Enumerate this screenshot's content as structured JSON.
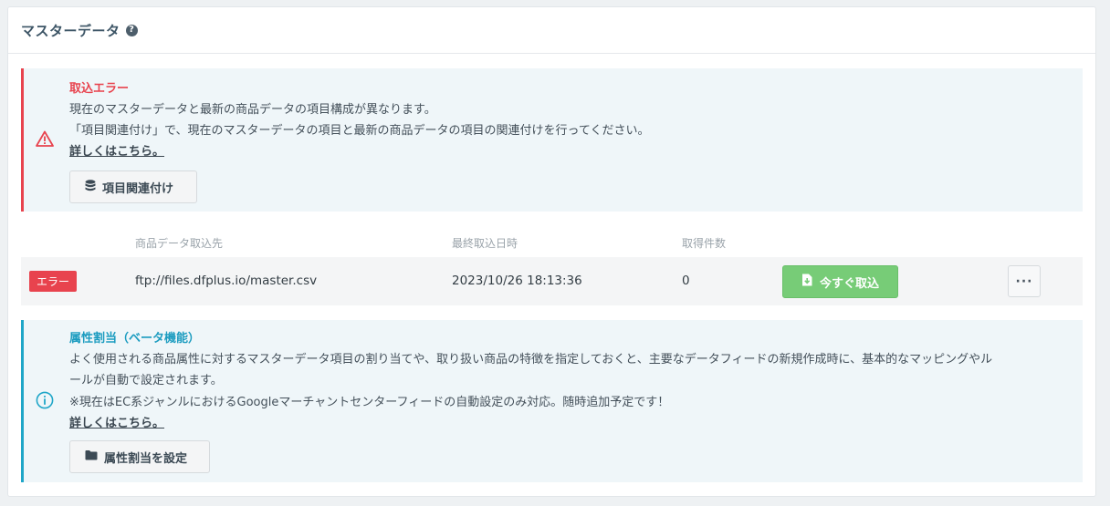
{
  "header": {
    "title": "マスターデータ",
    "help_icon": "question-circle-icon"
  },
  "error_alert": {
    "icon": "warning-triangle-icon",
    "title": "取込エラー",
    "line1": "現在のマスターデータと最新の商品データの項目構成が異なります。",
    "line2": "「項目関連付け」で、現在のマスターデータの項目と最新の商品データの項目の関連付けを行ってください。",
    "link": "詳しくはこちら。",
    "button_label": "項目関連付け",
    "button_icon": "database-icon",
    "accent": "#e8434e"
  },
  "table": {
    "columns": {
      "source": "商品データ取込先",
      "last_import": "最終取込日時",
      "count": "取得件数"
    },
    "row": {
      "status": "エラー",
      "source": "ftp://files.dfplus.io/master.csv",
      "last_import": "2023/10/26 18:13:36",
      "count": "0",
      "import_button": "今すぐ取込",
      "import_icon": "file-import-icon",
      "more_label": "···"
    }
  },
  "info_alert": {
    "icon": "info-circle-icon",
    "title": "属性割当（ベータ機能）",
    "line1": "よく使用される商品属性に対するマスターデータ項目の割り当てや、取り扱い商品の特徴を指定しておくと、主要なデータフィードの新規作成時に、基本的なマッピングやル",
    "line2": "ールが自動で設定されます。",
    "note": "※現在はEC系ジャンルにおけるGoogleマーチャントセンターフィードの自動設定のみ対応。随時追加予定です！",
    "link": "詳しくはこちら。",
    "button_label": "属性割当を設定",
    "button_icon": "folder-icon",
    "accent": "#1fa6c8"
  }
}
